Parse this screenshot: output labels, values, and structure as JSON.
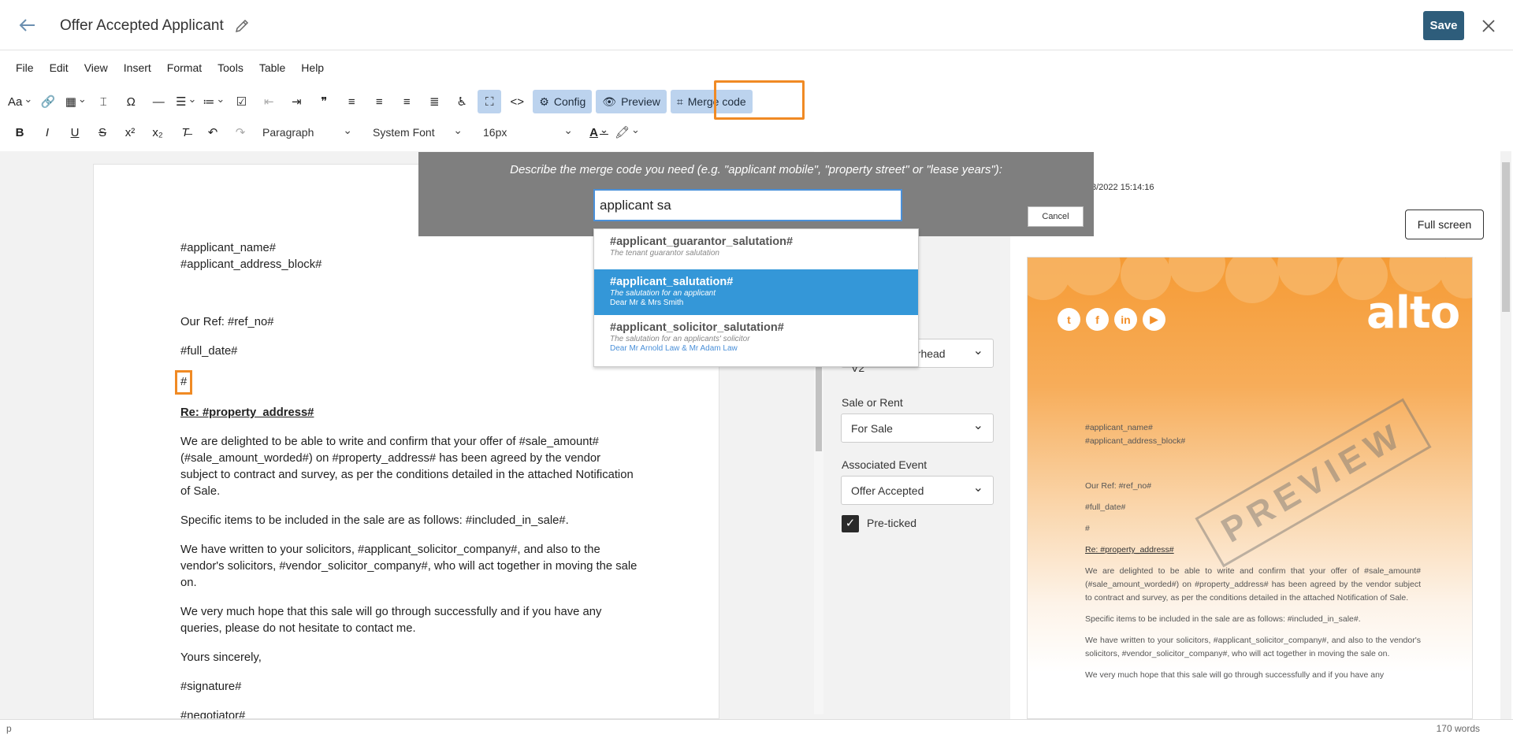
{
  "header": {
    "title": "Offer Accepted Applicant",
    "save_label": "Save"
  },
  "menu": [
    "File",
    "Edit",
    "View",
    "Insert",
    "Format",
    "Tools",
    "Table",
    "Help"
  ],
  "toolbar": {
    "config_label": "Config",
    "preview_label": "Preview",
    "merge_code_label": "Merge code",
    "block_format": "Paragraph",
    "font_family": "System Font",
    "font_size": "16px"
  },
  "letter": {
    "line1": "#applicant_name#",
    "line2": "#applicant_address_block#",
    "ref": "Our Ref: #ref_no#",
    "date": "#full_date#",
    "hash": "#",
    "re": "Re: #property_address#",
    "p1": "We are delighted to be able to write and confirm that your offer of #sale_amount# (#sale_amount_worded#) on #property_address# has been agreed by the vendor subject to contract and survey, as per the conditions detailed in the attached Notification of Sale.",
    "p2": "Specific items to be included in the sale are as follows: #included_in_sale#.",
    "p3": "We have written to your solicitors, #applicant_solicitor_company#, and also to the vendor's solicitors, #vendor_solicitor_company#, who will act together in moving the sale on.",
    "p4": "We very much hope that this sale will go through successfully and if you have any queries, please do not hesitate to contact me.",
    "closing": "Yours sincerely,",
    "signature": "#signature#",
    "negotiator": "#negotiator#"
  },
  "config": {
    "letterhead_value": "V2",
    "letterhead_partial": "erhead",
    "sale_or_rent_label": "Sale or Rent",
    "sale_or_rent_value": "For Sale",
    "associated_event_label": "Associated Event",
    "associated_event_value": "Offer Accepted",
    "preticked_label": "Pre-ticked"
  },
  "preview": {
    "timestamp": "8/2022 15:14:16",
    "fullscreen_label": "Full screen",
    "logo": "alto",
    "social": [
      "t",
      "f",
      "in",
      "▶"
    ],
    "watermark": "PREVIEW",
    "letter": {
      "line1": "#applicant_name#",
      "line2": "#applicant_address_block#",
      "ref": "Our Ref: #ref_no#",
      "date": "#full_date#",
      "hash": "#",
      "re": "Re: #property_address#",
      "p1": "We are delighted to be able to write and confirm that your offer of #sale_amount# (#sale_amount_worded#) on #property_address# has been agreed by the vendor subject to contract and survey, as per the conditions detailed in the attached Notification of Sale.",
      "p2": "Specific items to be included in the sale are as follows: #included_in_sale#.",
      "p3": "We have written to your solicitors, #applicant_solicitor_company#, and also to the vendor's solicitors, #vendor_solicitor_company#, who will act together in moving the sale on.",
      "p4": "We very much hope that this sale will go through successfully and if you have any"
    }
  },
  "merge": {
    "prompt": "Describe the merge code you need (e.g. \"applicant mobile\", \"property street\" or \"lease years\"):",
    "input_value": "applicant sa",
    "cancel_label": "Cancel",
    "suggestions": [
      {
        "code": "#applicant_guarantor_salutation#",
        "desc": "The tenant guarantor salutation",
        "example": ""
      },
      {
        "code": "#applicant_salutation#",
        "desc": "The salutation for an applicant",
        "example": "Dear Mr & Mrs Smith"
      },
      {
        "code": "#applicant_solicitor_salutation#",
        "desc": "The salutation for an applicants' solicitor",
        "example": "Dear Mr Arnold Law & Mr Adam Law"
      }
    ]
  },
  "status": {
    "path": "p",
    "word_count": "170 words"
  },
  "colors": {
    "save": "#2e5d7b",
    "highlight": "#f08a24",
    "selected_suggestion": "#3497d8",
    "brand_orange": "#f59b35"
  }
}
